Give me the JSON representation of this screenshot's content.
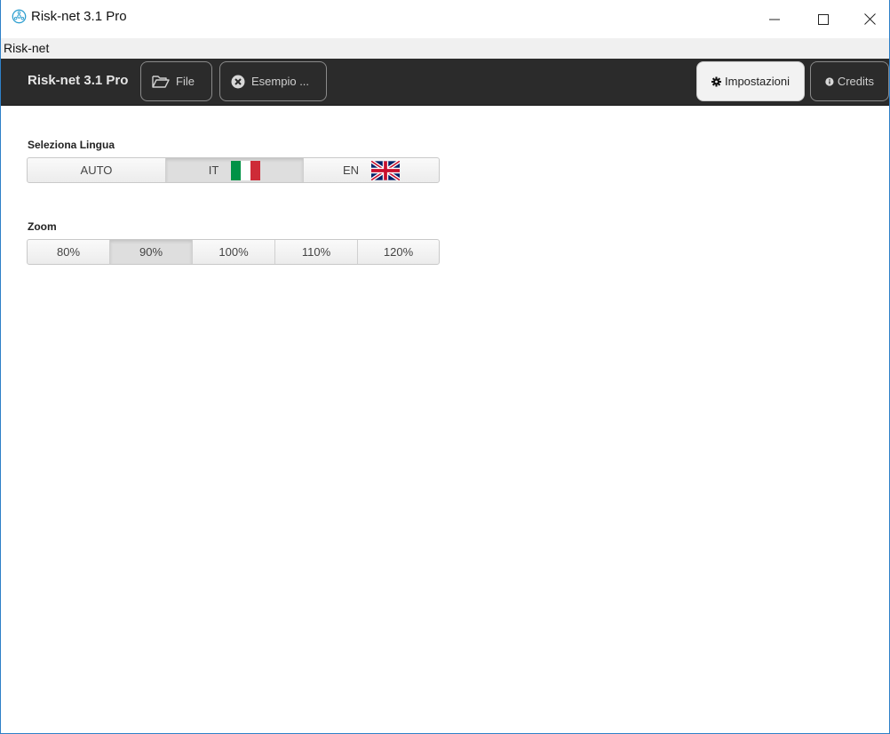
{
  "window": {
    "title": "Risk-net 3.1 Pro",
    "controls": {
      "minimize": "minimize-icon",
      "maximize": "maximize-icon",
      "close": "close-icon"
    }
  },
  "menubar": {
    "items": [
      {
        "label": "Risk-net"
      }
    ]
  },
  "toolbar": {
    "brand": "Risk-net 3.1 Pro",
    "file_label": "File",
    "esempio_label": "Esempio ...",
    "impostazioni_label": "Impostazioni",
    "credits_label": "Credits",
    "dark_bg": "#2b2b2b"
  },
  "settings": {
    "language": {
      "label": "Seleziona Lingua",
      "options": [
        {
          "label": "AUTO"
        },
        {
          "label": "IT"
        },
        {
          "label": "EN"
        }
      ],
      "selected": "IT"
    },
    "zoom": {
      "label": "Zoom",
      "options": [
        {
          "label": "80%"
        },
        {
          "label": "90%"
        },
        {
          "label": "100%"
        },
        {
          "label": "110%"
        },
        {
          "label": "120%"
        }
      ],
      "selected": "90%"
    }
  },
  "colors": {
    "flag_it": [
      "#009246",
      "#ffffff",
      "#ce2b37"
    ],
    "accent_border": "#2e80c8"
  }
}
